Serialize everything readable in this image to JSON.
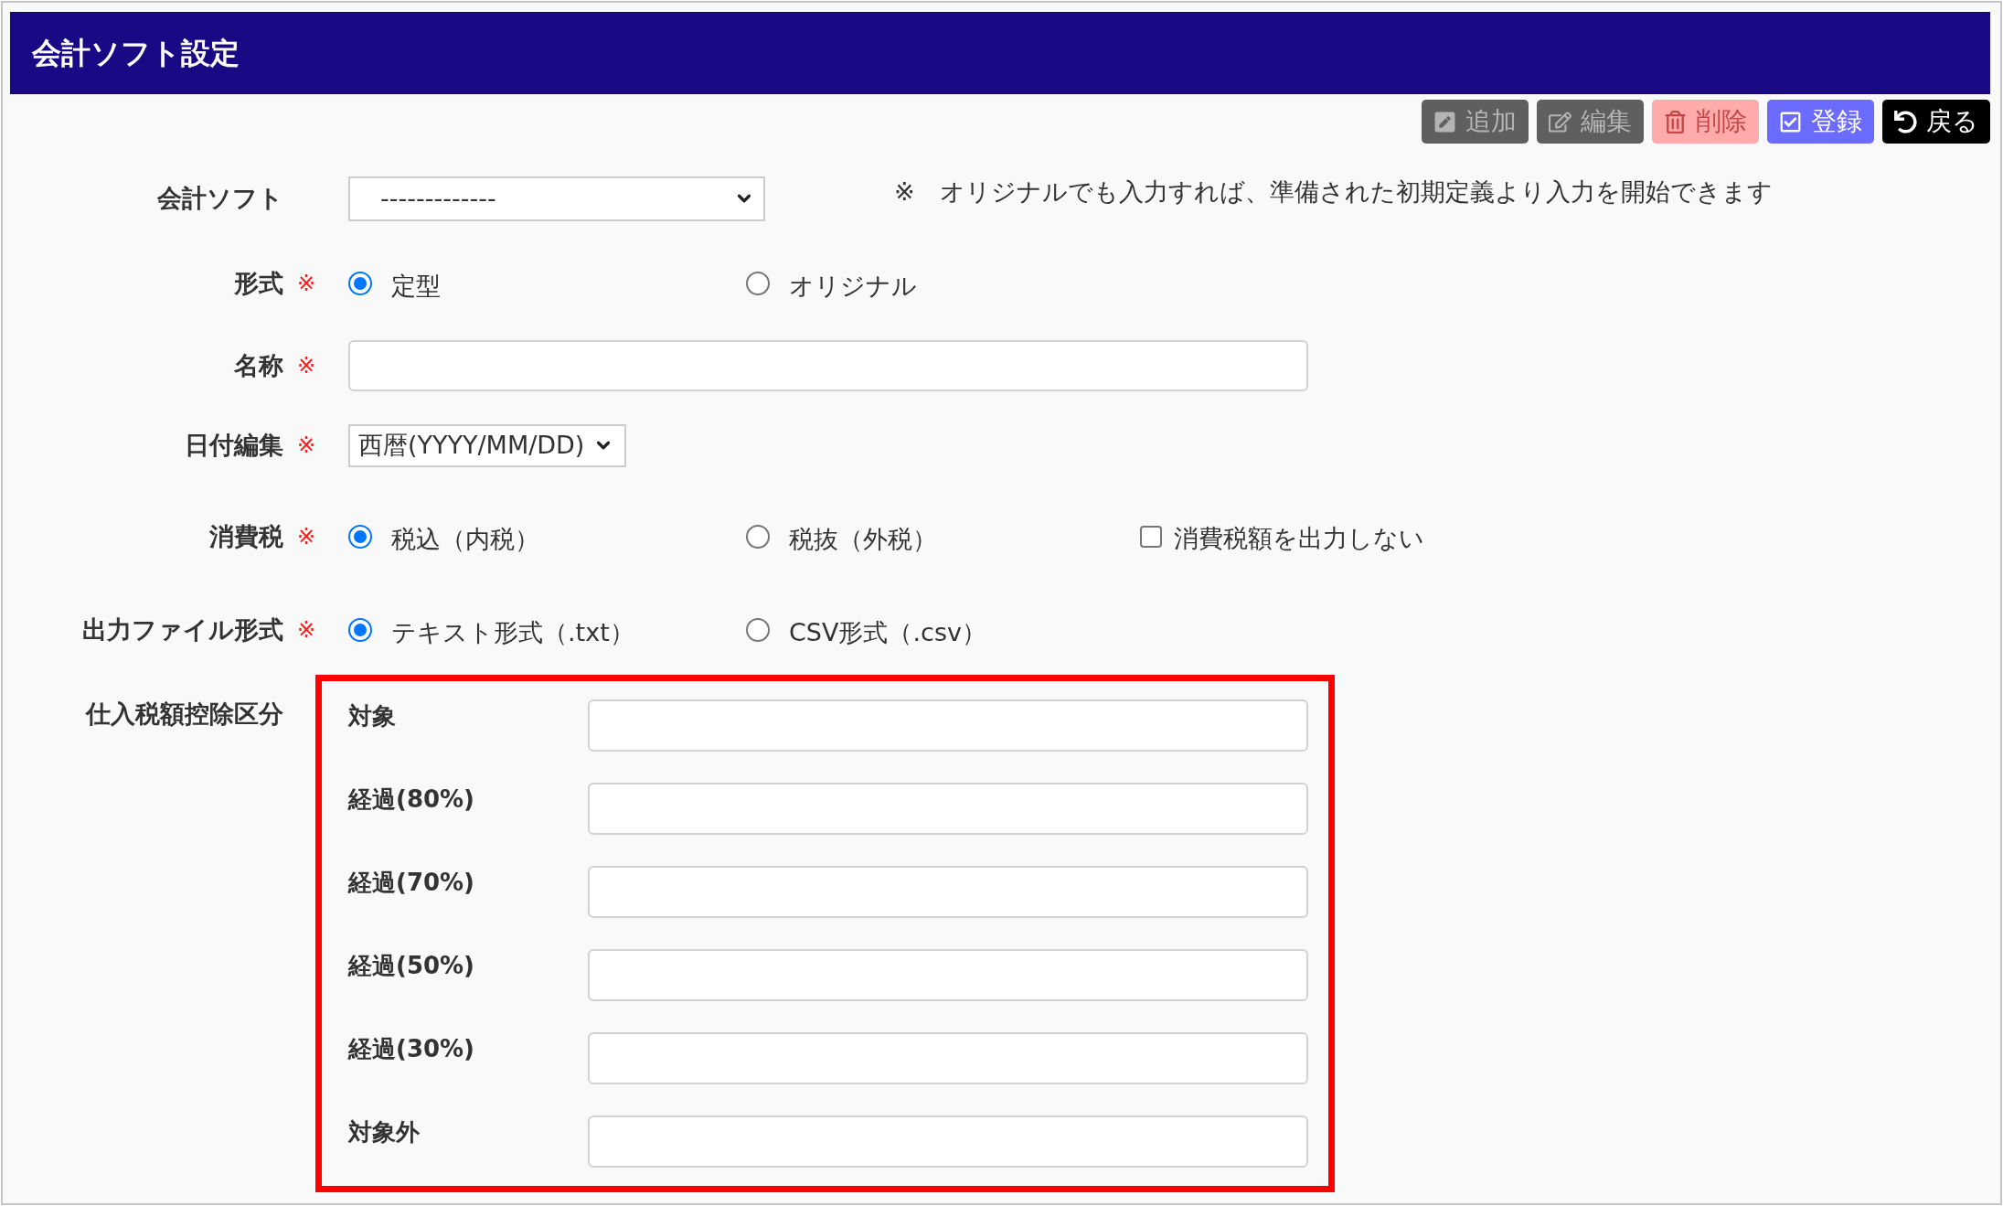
{
  "header": {
    "title": "会計ソフト設定"
  },
  "toolbar": {
    "buttons": [
      {
        "label": "追加",
        "kind": "add",
        "disabled": true
      },
      {
        "label": "編集",
        "kind": "edit",
        "disabled": true
      },
      {
        "label": "削除",
        "kind": "delete",
        "disabled": true
      },
      {
        "label": "登録",
        "kind": "register",
        "disabled": false
      },
      {
        "label": "戻る",
        "kind": "back",
        "disabled": false
      }
    ]
  },
  "form": {
    "rows": [
      {
        "kind": "select",
        "label": "会計ソフト",
        "value": "-------------",
        "note": "※　オリジナルでも入力すれば、準備された初期定義より入力を開始できます"
      },
      {
        "kind": "radio",
        "label": "形式",
        "required_mark": "※",
        "options": [
          {
            "label": "定型",
            "selected": true
          },
          {
            "label": "オリジナル",
            "selected": false
          }
        ]
      },
      {
        "kind": "text",
        "label": "名称",
        "required_mark": "※"
      },
      {
        "kind": "select",
        "label": "日付編集",
        "required_mark": "※",
        "value": "西暦(YYYY/MM/DD)"
      },
      {
        "kind": "radio",
        "label": "消費税",
        "required_mark": "※",
        "options": [
          {
            "label": "税込（内税）",
            "selected": true
          },
          {
            "label": "税抜（外税）",
            "selected": false
          }
        ],
        "checkbox": {
          "label": "消費税額を出力しない",
          "checked": false
        }
      },
      {
        "kind": "radio",
        "label": "出力ファイル形式",
        "required_mark": "※",
        "options": [
          {
            "label": "テキスト形式（.txt）",
            "selected": true
          },
          {
            "label": "CSV形式（.csv）",
            "selected": false
          }
        ]
      },
      {
        "kind": "group",
        "label": "仕入税額控除区分",
        "highlighted": true,
        "fields": [
          {
            "label": "対象"
          },
          {
            "label": "経過(80%)"
          },
          {
            "label": "経過(70%)"
          },
          {
            "label": "経過(50%)"
          },
          {
            "label": "経過(30%)"
          },
          {
            "label": "対象外"
          }
        ]
      }
    ]
  }
}
